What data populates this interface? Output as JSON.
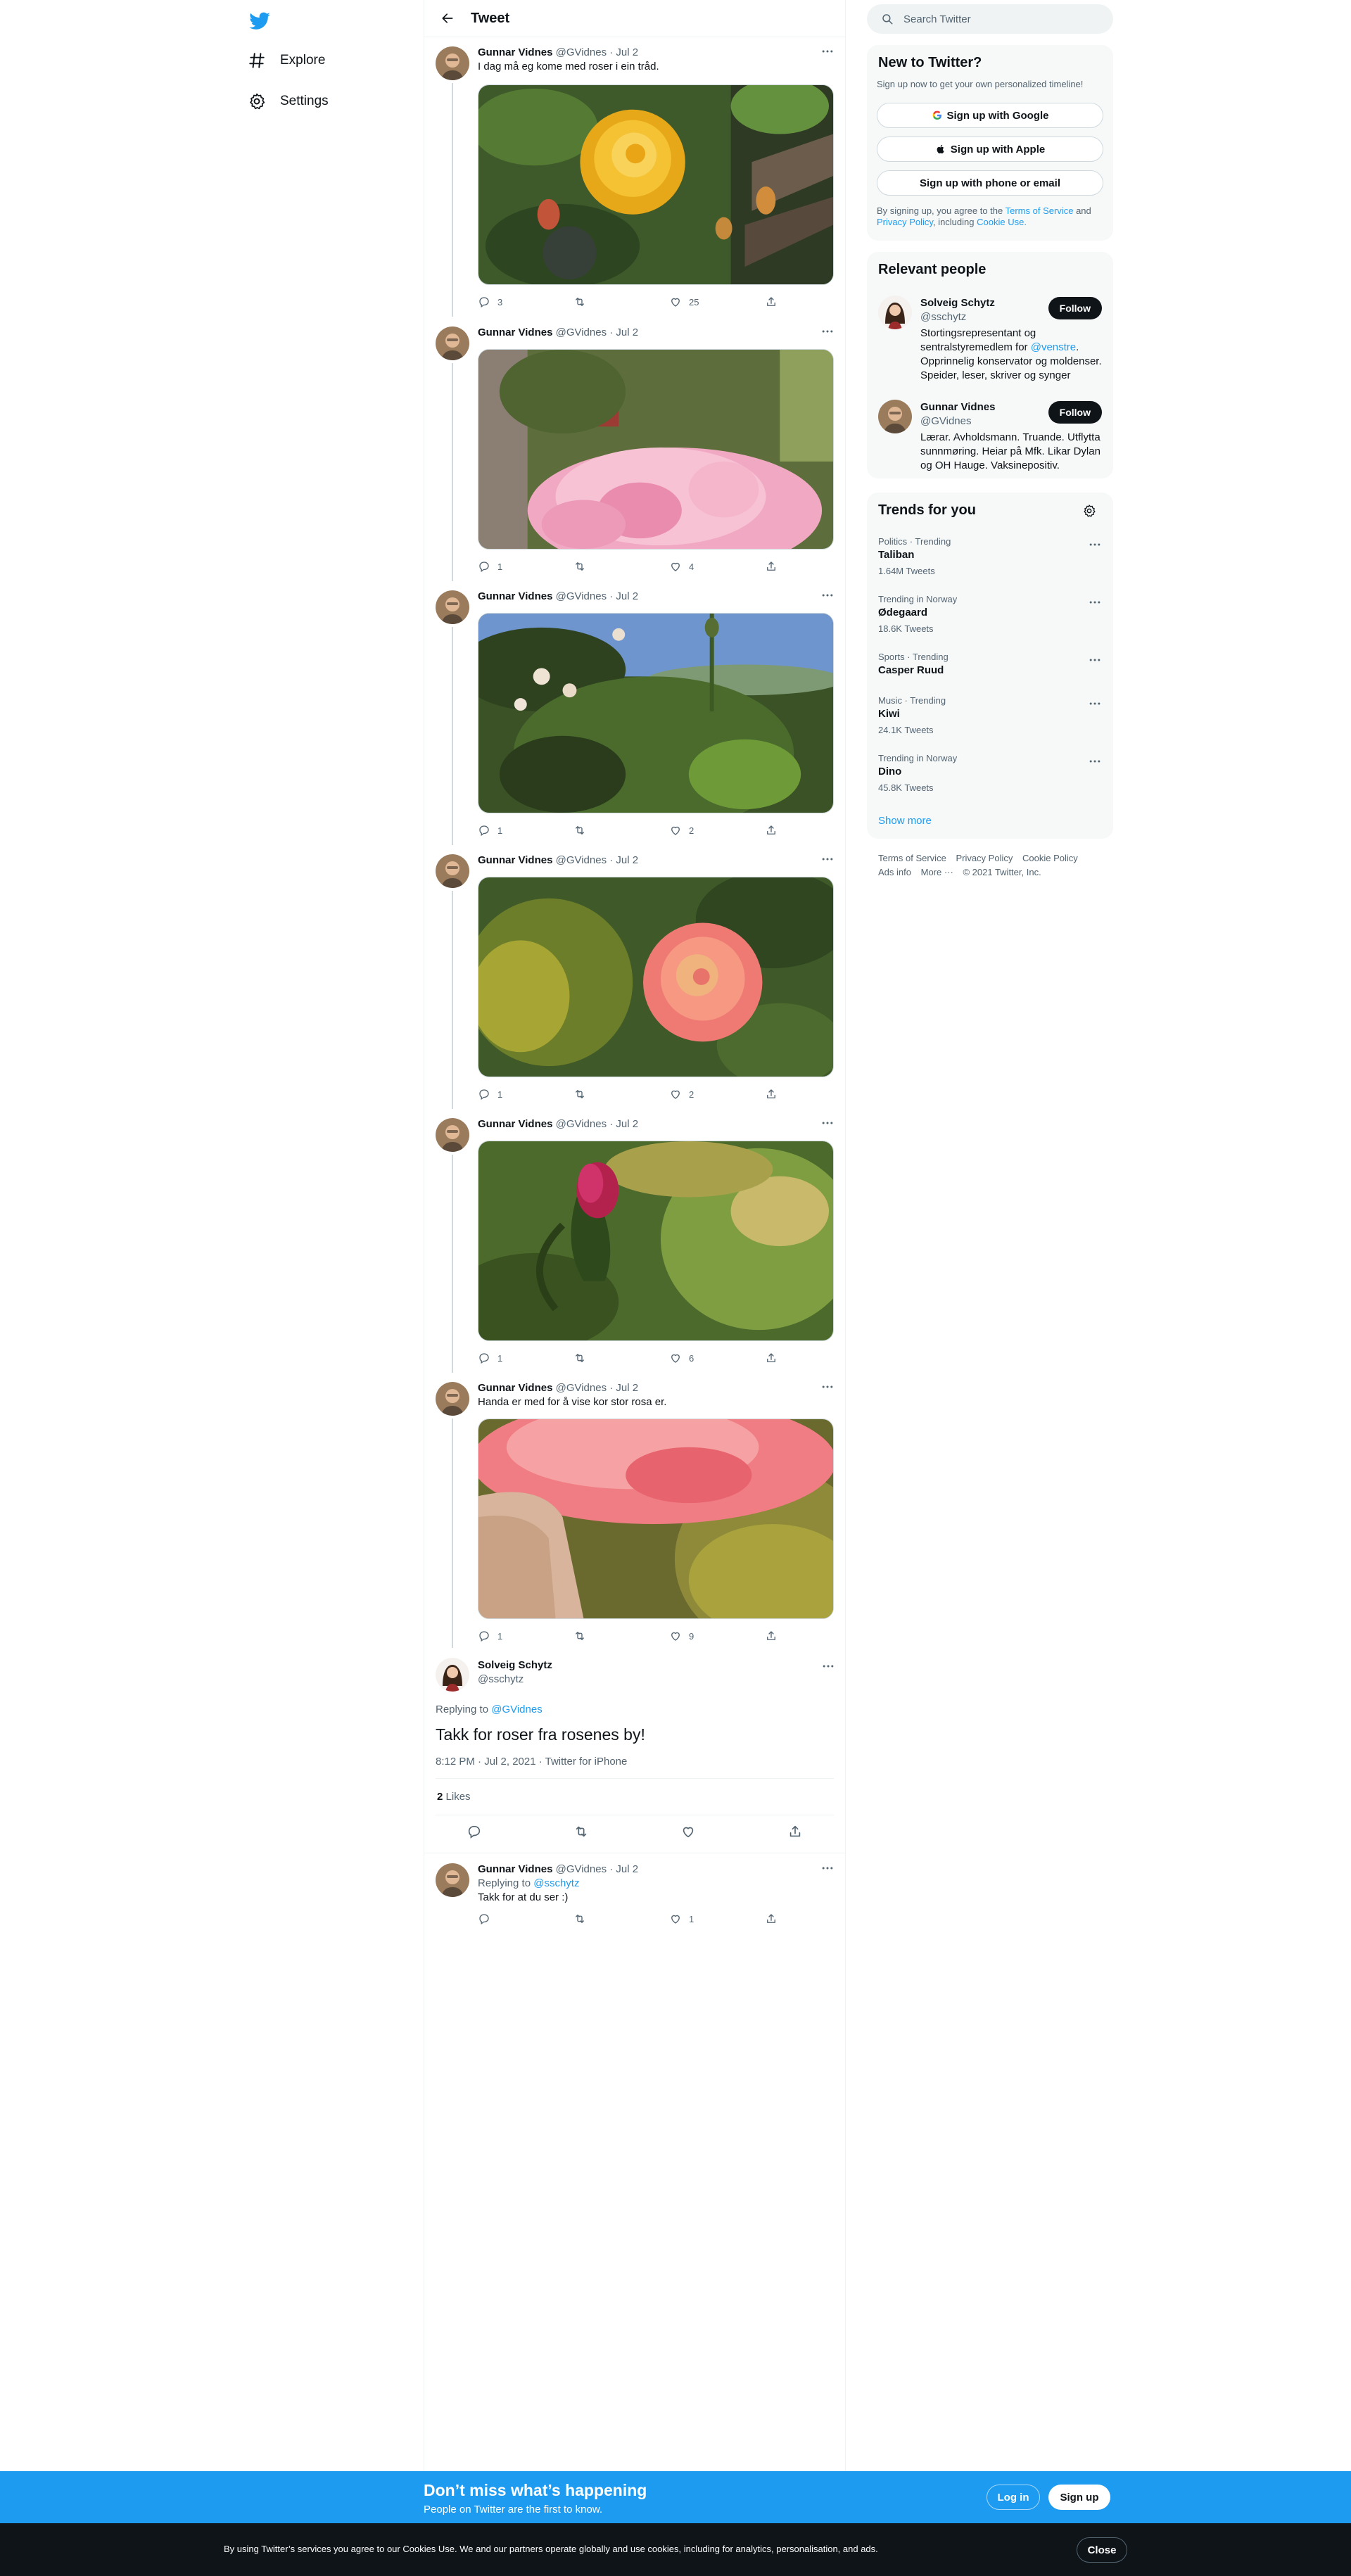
{
  "colors": {
    "accent": "#1d9bf0",
    "text": "#0f1419",
    "muted": "#536471",
    "card_bg": "#f7f9f9",
    "cookie_bg": "#0f1419"
  },
  "nav": {
    "logo_icon": "twitter-bird-icon",
    "items": [
      {
        "label": "Explore",
        "icon": "hashtag-icon"
      },
      {
        "label": "Settings",
        "icon": "gear-icon"
      }
    ]
  },
  "header": {
    "title": "Tweet",
    "back_icon": "back-arrow-icon"
  },
  "thread": [
    {
      "name": "Gunnar Vidnes",
      "handle_date": "@GVidnes · Jul 2",
      "text": "I dag må eg kome med roser i ein tråd.",
      "image": "yellow-rose-photo",
      "replies": "3",
      "retweets": "",
      "likes": "25"
    },
    {
      "name": "Gunnar Vidnes",
      "handle_date": "@GVidnes · Jul 2",
      "text": "",
      "image": "pink-rose-photo",
      "replies": "1",
      "retweets": "",
      "likes": "4"
    },
    {
      "name": "Gunnar Vidnes",
      "handle_date": "@GVidnes · Jul 2",
      "text": "",
      "image": "white-roses-garden-photo",
      "replies": "1",
      "retweets": "",
      "likes": "2"
    },
    {
      "name": "Gunnar Vidnes",
      "handle_date": "@GVidnes · Jul 2",
      "text": "",
      "image": "coral-rose-photo",
      "replies": "1",
      "retweets": "",
      "likes": "2"
    },
    {
      "name": "Gunnar Vidnes",
      "handle_date": "@GVidnes · Jul 2",
      "text": "",
      "image": "rosebud-photo",
      "replies": "1",
      "retweets": "",
      "likes": "6"
    },
    {
      "name": "Gunnar Vidnes",
      "handle_date": "@GVidnes · Jul 2",
      "text": "Handa er med for å vise kor stor rosa er.",
      "image": "rose-in-hand-photo",
      "replies": "1",
      "retweets": "",
      "likes": "9"
    }
  ],
  "focus": {
    "name": "Solveig Schytz",
    "handle": "@sschytz",
    "replying_prefix": "Replying to",
    "replying_to": "@GVidnes",
    "text": "Takk for roser fra rosenes by!",
    "meta": "8:12 PM · Jul 2, 2021 · Twitter for iPhone",
    "likes_count": "2",
    "likes_label": "Likes"
  },
  "reply": {
    "name": "Gunnar Vidnes",
    "handle_date": "@GVidnes · Jul 2",
    "replying_prefix": "Replying to",
    "replying_to": "@sschytz",
    "text": "Takk for at du ser :)",
    "likes": "1"
  },
  "search": {
    "placeholder": "Search Twitter"
  },
  "new_to_twitter": {
    "title": "New to Twitter?",
    "subtitle": "Sign up now to get your own personalized timeline!",
    "google": "Sign up with Google",
    "apple": "Sign up with Apple",
    "phone": "Sign up with phone or email",
    "legal_1": "By signing up, you agree to the",
    "terms": "Terms of Service",
    "and": "and",
    "privacy": "Privacy Policy",
    "including": ", including",
    "cookie": "Cookie Use."
  },
  "relevant": {
    "title": "Relevant people",
    "follow_label": "Follow",
    "people": [
      {
        "name": "Solveig Schytz",
        "handle": "@sschytz",
        "bio_1": "Stortingsrepresentant og sentralstyremedlem for ",
        "bio_link": "@venstre",
        "bio_2": ". Opprinnelig konservator og moldenser. Speider, leser, skriver og synger"
      },
      {
        "name": "Gunnar Vidnes",
        "handle": "@GVidnes",
        "bio_1": "Lærar. Avholdsmann. Truande. Utflytta sunnmøring. Heiar på Mfk. Likar Dylan og OH Hauge. Vaksinepositiv.",
        "bio_link": "",
        "bio_2": ""
      }
    ]
  },
  "trends": {
    "title": "Trends for you",
    "items": [
      {
        "context": "Politics · Trending",
        "name": "Taliban",
        "count": "1.64M Tweets"
      },
      {
        "context": "Trending in Norway",
        "name": "Ødegaard",
        "count": "18.6K Tweets"
      },
      {
        "context": "Sports · Trending",
        "name": "Casper Ruud",
        "count": ""
      },
      {
        "context": "Music · Trending",
        "name": "Kiwi",
        "count": "24.1K Tweets"
      },
      {
        "context": "Trending in Norway",
        "name": "Dino",
        "count": "45.8K Tweets"
      }
    ],
    "show_more": "Show more"
  },
  "footer": {
    "terms": "Terms of Service",
    "privacy": "Privacy Policy",
    "cookie": "Cookie Policy",
    "ads": "Ads info",
    "more": "More ···",
    "copyright": "© 2021 Twitter, Inc."
  },
  "signup_bar": {
    "title": "Don’t miss what’s happening",
    "subtitle": "People on Twitter are the first to know.",
    "login": "Log in",
    "signup": "Sign up"
  },
  "cookie_bar": {
    "text": "By using Twitter’s services you agree to our Cookies Use. We and our partners operate globally and use cookies, including for analytics, personalisation, and ads.",
    "close": "Close"
  }
}
